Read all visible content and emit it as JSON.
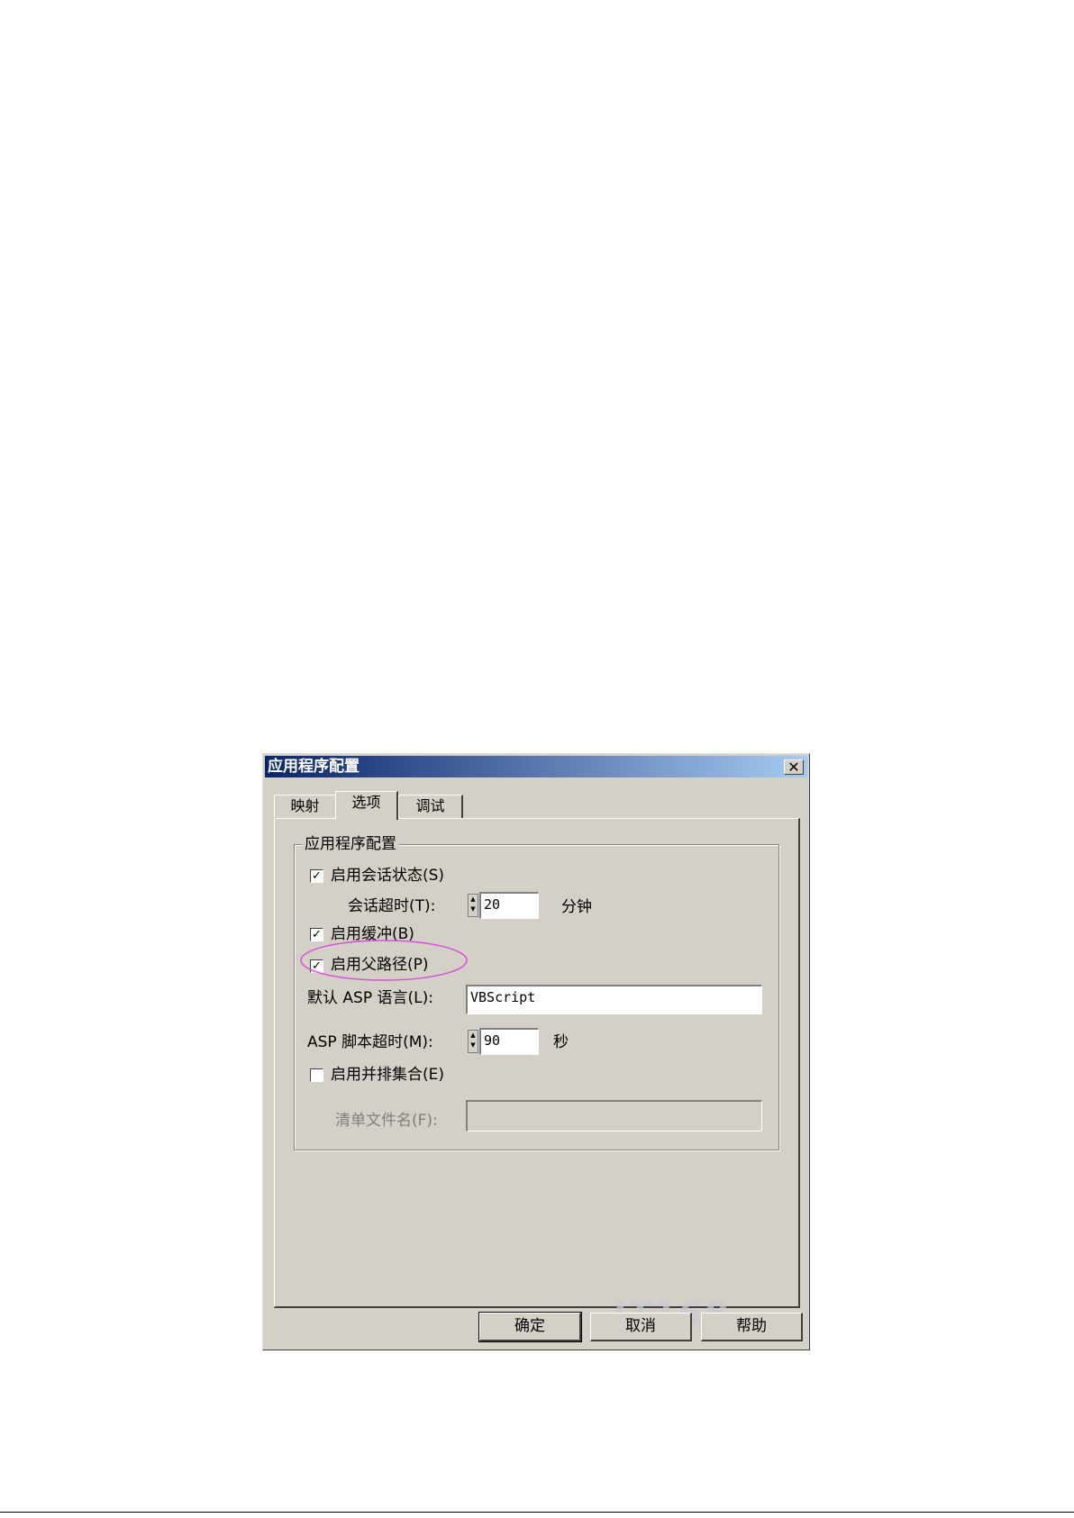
{
  "dialog": {
    "title": "应用程序配置",
    "close_glyph": "✕",
    "tabs": [
      {
        "label": "映射"
      },
      {
        "label": "选项"
      },
      {
        "label": "调试"
      }
    ],
    "group": {
      "title": "应用程序配置",
      "enable_session_state": {
        "label": "启用会话状态(S)",
        "checked": true
      },
      "session_timeout": {
        "label": "会话超时(T):",
        "value": "20",
        "unit": "分钟"
      },
      "enable_buffering": {
        "label": "启用缓冲(B)",
        "checked": true
      },
      "enable_parent_paths": {
        "label": "启用父路径(P)",
        "checked": true
      },
      "default_asp_language": {
        "label": "默认 ASP 语言(L):",
        "value": "VBScript"
      },
      "asp_script_timeout": {
        "label": "ASP 脚本超时(M):",
        "value": "90",
        "unit": "秒"
      },
      "enable_side_by_side": {
        "label": "启用并排集合(E)",
        "checked": false
      },
      "manifest_file": {
        "label": "清单文件名(F):",
        "value": ""
      }
    },
    "buttons": {
      "ok": "确定",
      "cancel": "取消",
      "help": "帮助"
    },
    "check_glyph": "✓",
    "spin_glyphs": {
      "up": "▲",
      "down": "▼"
    },
    "watermark": "IT168",
    "highlight_color": "#d84fd8"
  }
}
